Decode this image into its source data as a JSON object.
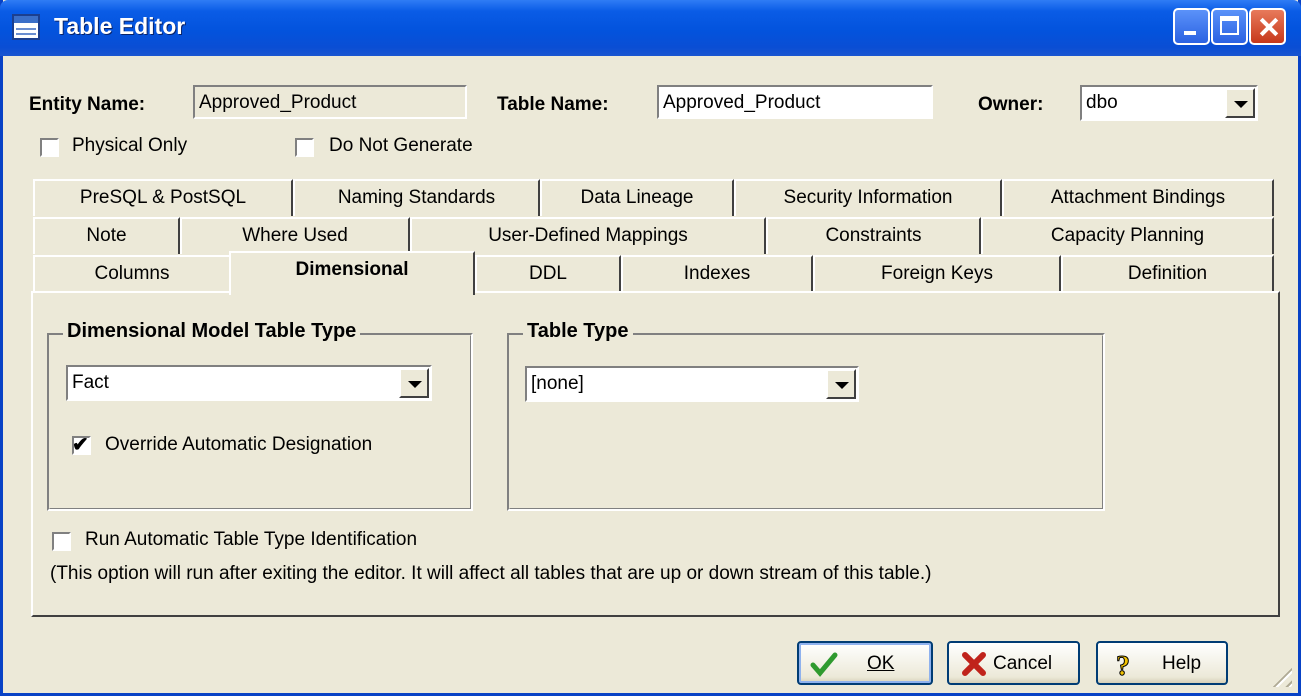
{
  "window": {
    "title": "Table Editor"
  },
  "header": {
    "entity_name_label": "Entity Name:",
    "entity_name_value": "Approved_Product",
    "table_name_label": "Table Name:",
    "table_name_value": "Approved_Product",
    "owner_label": "Owner:",
    "owner_value": "dbo",
    "physical_only_label": "Physical Only",
    "physical_only_checked": false,
    "do_not_generate_label": "Do Not Generate",
    "do_not_generate_checked": false
  },
  "tabs": {
    "row1": [
      "PreSQL & PostSQL",
      "Naming Standards",
      "Data Lineage",
      "Security Information",
      "Attachment Bindings"
    ],
    "row2": [
      "Note",
      "Where Used",
      "User-Defined Mappings",
      "Constraints",
      "Capacity Planning"
    ],
    "row3": [
      "Columns",
      "Dimensional",
      "DDL",
      "Indexes",
      "Foreign Keys",
      "Definition"
    ],
    "active": "Dimensional"
  },
  "dimensional": {
    "model_type_title": "Dimensional Model Table Type",
    "model_type_value": "Fact",
    "override_label": "Override Automatic Designation",
    "override_checked": true,
    "table_type_title": "Table Type",
    "table_type_value": "[none]",
    "run_auto_label": "Run Automatic Table Type Identification",
    "run_auto_checked": false,
    "note": "(This option will run after exiting the editor.  It will affect all tables that are up or down stream of this table.)"
  },
  "buttons": {
    "ok": "OK",
    "cancel": "Cancel",
    "help": "Help"
  },
  "colors": {
    "titlebar": "#0a5ce6",
    "face": "#ece9d8",
    "close": "#c6381b"
  }
}
